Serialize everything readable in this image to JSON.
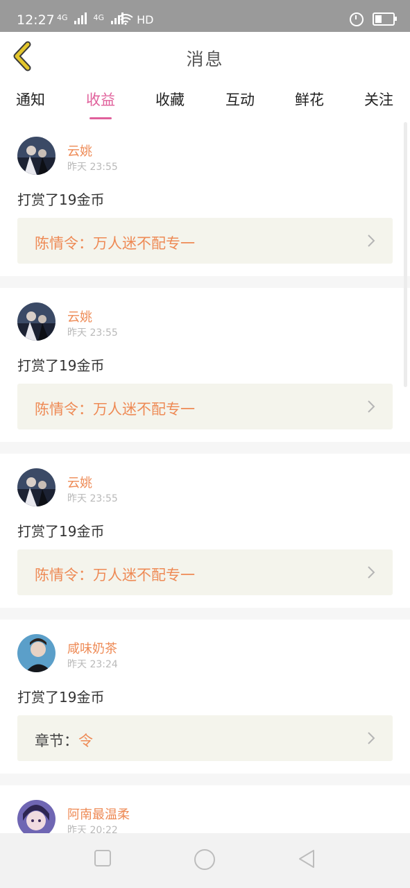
{
  "status_bar": {
    "time": "12:27",
    "network_1": "4G",
    "network_2": "4G",
    "hd": "HD",
    "battery_level": 0.3
  },
  "header": {
    "title": "消息",
    "back_icon": "chevron-left-icon",
    "accent": "#e0609b",
    "back_color": "#d8b81c"
  },
  "tabs": [
    {
      "label": "通知",
      "active": false
    },
    {
      "label": "收益",
      "active": true
    },
    {
      "label": "收藏",
      "active": false
    },
    {
      "label": "互动",
      "active": false
    },
    {
      "label": "鲜花",
      "active": false
    },
    {
      "label": "关注",
      "active": false
    }
  ],
  "messages": [
    {
      "user": "云姚",
      "time": "昨天 23:55",
      "text": "打赏了19金币",
      "ref_label": "",
      "ref_title": "陈情令：万人迷不配专一",
      "avatar": "avatar-dark-art"
    },
    {
      "user": "云姚",
      "time": "昨天 23:55",
      "text": "打赏了19金币",
      "ref_label": "",
      "ref_title": "陈情令：万人迷不配专一",
      "avatar": "avatar-dark-art"
    },
    {
      "user": "云姚",
      "time": "昨天 23:55",
      "text": "打赏了19金币",
      "ref_label": "",
      "ref_title": "陈情令：万人迷不配专一",
      "avatar": "avatar-dark-art"
    },
    {
      "user": "咸味奶茶",
      "time": "昨天 23:24",
      "text": "打赏了19金币",
      "ref_label": "章节：",
      "ref_title": "令",
      "avatar": "avatar-portrait-blue"
    },
    {
      "user": "阿南最温柔",
      "time": "昨天 20:22",
      "text": "",
      "ref_label": "",
      "ref_title": "",
      "avatar": "avatar-anime-purple"
    }
  ],
  "colors": {
    "username": "#ee8a55",
    "ref_bg": "#f4f4ec",
    "gap": "#f6f6f6"
  }
}
